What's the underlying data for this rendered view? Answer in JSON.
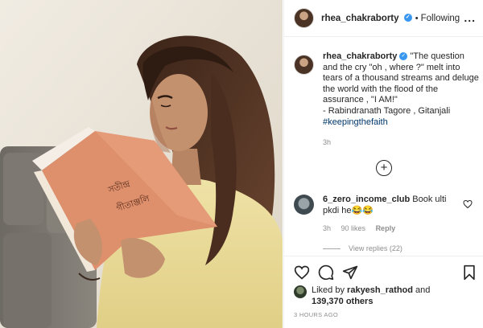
{
  "colors": {
    "link": "#00376b",
    "verified": "#3897f0",
    "muted": "#8e8e8e",
    "text": "#262626"
  },
  "post": {
    "username": "rhea_chakraborty",
    "verified": true,
    "separator": "•",
    "follow_status": "Following",
    "more_icon": "ellipsis-icon",
    "more_label": "..."
  },
  "caption": {
    "username": "rhea_chakraborty",
    "line1": "\"The question and the cry \"oh , where ?\" melt into tears of a thousand streams and deluge the world with the flood of the assurance , \"I AM!\"",
    "attribution": "- Rabindranath Tagore , Gitanjali",
    "hashtag": "#keepingthefaith",
    "time": "3h"
  },
  "load_more": {
    "icon": "plus-circle-icon",
    "label": "+"
  },
  "comment": {
    "username": "6_zero_income_club",
    "text": "Book ulti pkdi he😂😂",
    "time": "3h",
    "likes": "90 likes",
    "reply": "Reply",
    "view_replies": "View replies (22)"
  },
  "actions": {
    "icons": [
      "heart-icon",
      "comment-icon",
      "share-icon",
      "bookmark-icon"
    ]
  },
  "likes": {
    "prefix": "Liked by",
    "user": "rakyesh_rathod",
    "middle": "and",
    "count": "139,370 others"
  },
  "posted_ago": "3 HOURS AGO",
  "book": {
    "title_line1": "সতীন্দ্র",
    "title_line2": "গীতাঞ্জলি"
  }
}
